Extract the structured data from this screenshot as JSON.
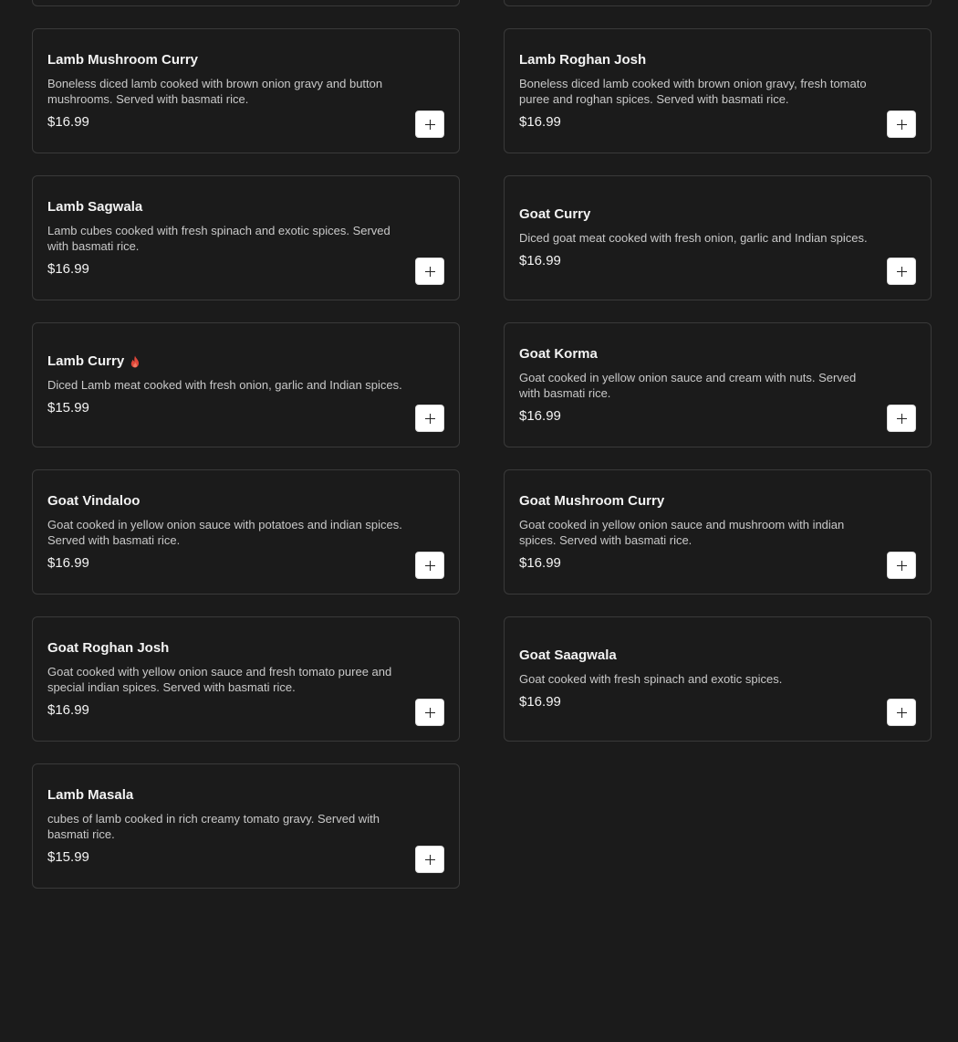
{
  "menu": {
    "items": [
      {
        "name": "Lamb Mushroom Curry",
        "description": "Boneless diced lamb cooked with brown onion gravy and button mushrooms. Served with basmati rice.",
        "price": "$16.99",
        "spicy": false
      },
      {
        "name": "Lamb Roghan Josh",
        "description": "Boneless diced lamb cooked with brown onion gravy, fresh tomato puree and roghan spices. Served with basmati rice.",
        "price": "$16.99",
        "spicy": false
      },
      {
        "name": "Lamb Sagwala",
        "description": "Lamb cubes cooked with fresh spinach and exotic spices. Served with basmati rice.",
        "price": "$16.99",
        "spicy": false
      },
      {
        "name": "Goat Curry",
        "description": "Diced goat meat cooked with fresh onion, garlic and Indian spices.",
        "price": "$16.99",
        "spicy": false
      },
      {
        "name": "Lamb Curry",
        "description": "Diced Lamb meat cooked with fresh onion, garlic and Indian spices.",
        "price": "$15.99",
        "spicy": true
      },
      {
        "name": "Goat Korma",
        "description": "Goat cooked in yellow onion sauce and cream with nuts. Served with basmati rice.",
        "price": "$16.99",
        "spicy": false
      },
      {
        "name": "Goat Vindaloo",
        "description": "Goat cooked in yellow onion sauce with potatoes and indian spices. Served with basmati rice.",
        "price": "$16.99",
        "spicy": false
      },
      {
        "name": "Goat Mushroom Curry",
        "description": "Goat cooked in yellow onion sauce and mushroom with indian spices. Served with basmati rice.",
        "price": "$16.99",
        "spicy": false
      },
      {
        "name": "Goat Roghan Josh",
        "description": "Goat cooked with yellow onion sauce and fresh tomato puree and special indian spices. Served with basmati rice.",
        "price": "$16.99",
        "spicy": false
      },
      {
        "name": "Goat Saagwala",
        "description": "Goat cooked with fresh spinach and exotic spices.",
        "price": "$16.99",
        "spicy": false
      },
      {
        "name": "Lamb Masala",
        "description": "cubes of lamb cooked in rich creamy tomato gravy. Served with basmati rice.",
        "price": "$15.99",
        "spicy": false
      }
    ],
    "add_button_icon": "plus-icon",
    "spicy_icon": "flame-icon"
  },
  "colors": {
    "background": "#1b1b1b",
    "card_border": "#3a3a3a",
    "spicy": "#e0473a",
    "add_button": "#ffffff"
  }
}
